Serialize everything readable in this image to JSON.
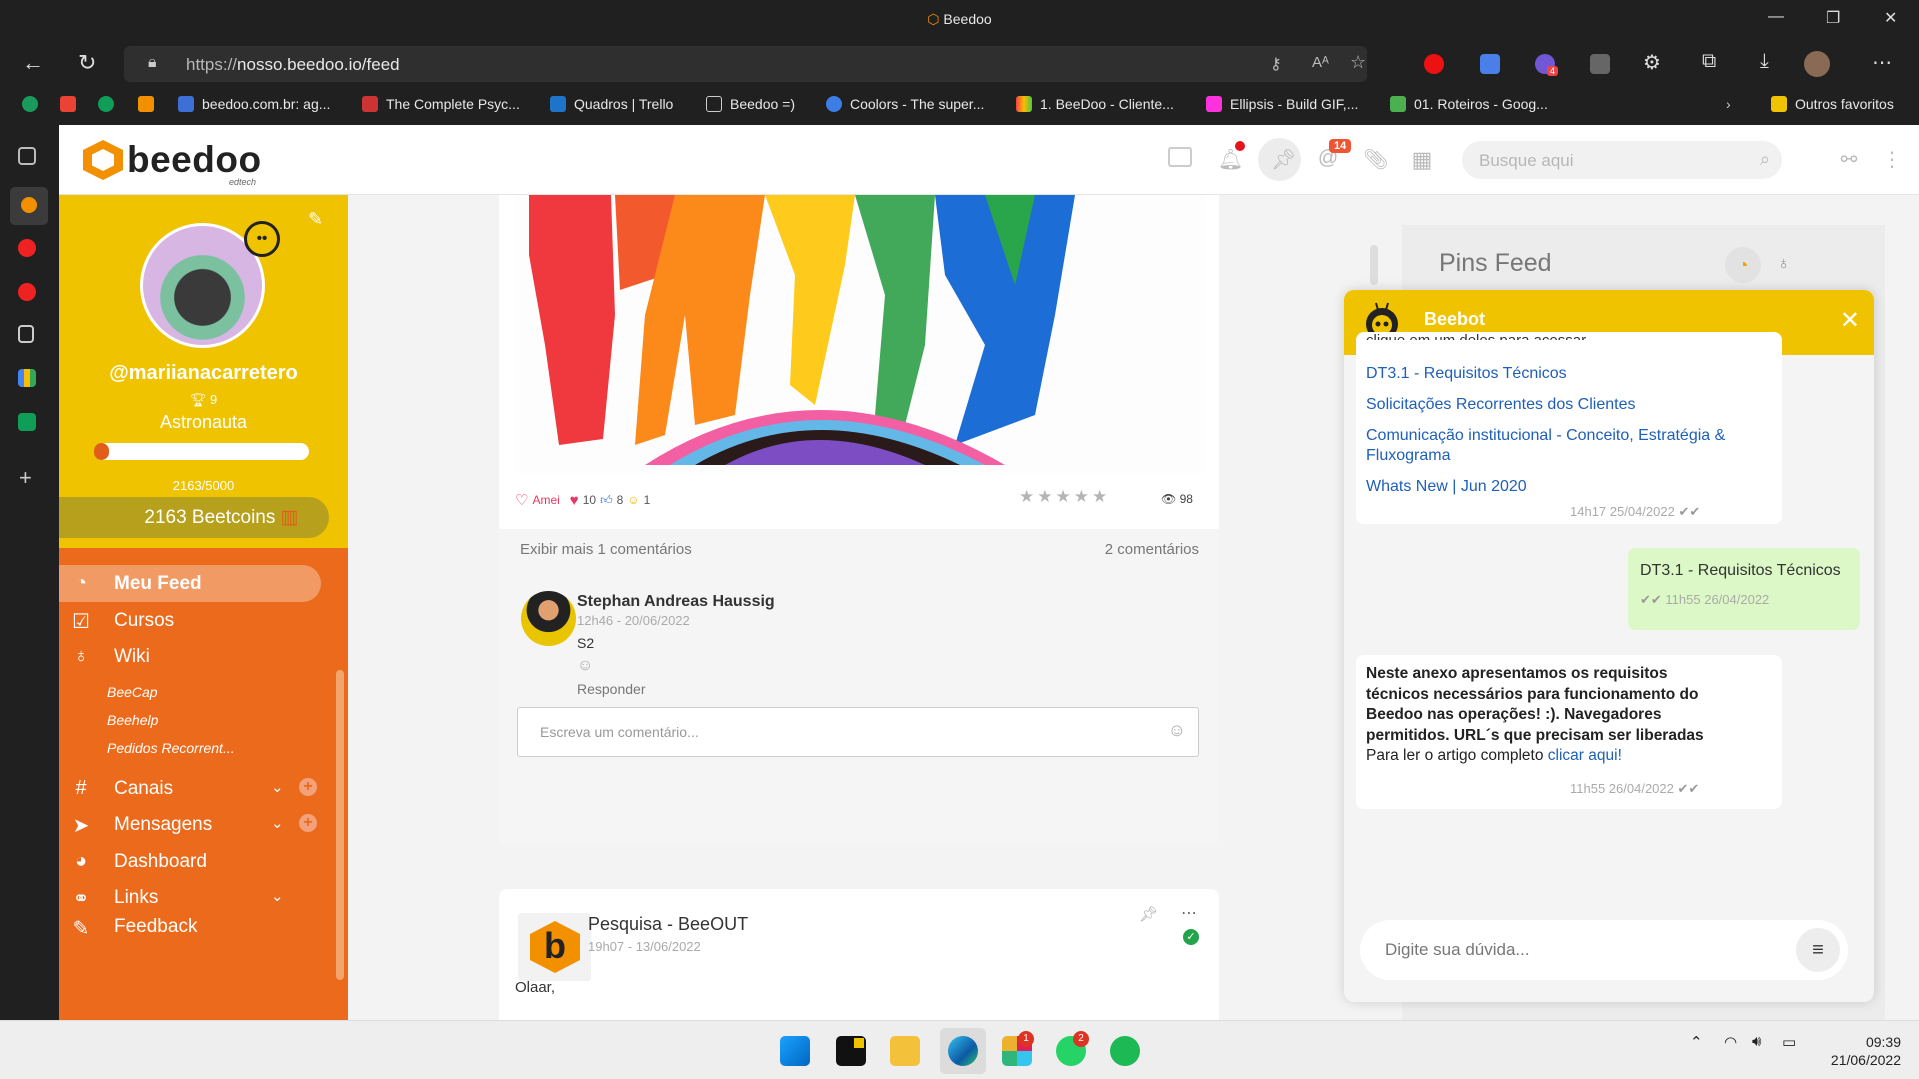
{
  "browser": {
    "window_title": "Beedoo",
    "url_prefix": "https://",
    "url_main": "nosso.beedoo.io/feed",
    "bookmarks": [
      {
        "label": "beedoo.com.br: ag...",
        "color": "#3d6fd6"
      },
      {
        "label": "The Complete Psyc...",
        "color": "#c33"
      },
      {
        "label": "Quadros | Trello",
        "color": "#1e74c8"
      },
      {
        "label": "Beedoo =)",
        "color": "#ddd"
      },
      {
        "label": "Coolors - The super...",
        "color": "#3c7ee6"
      },
      {
        "label": "1. BeeDoo - Cliente...",
        "color": "#e44"
      },
      {
        "label": "Ellipsis - Build GIF,...",
        "color": "#f3d"
      },
      {
        "label": "01. Roteiros - Goog...",
        "color": "#4caf50"
      },
      {
        "label": "Outros favoritos",
        "color": "#f0c300"
      }
    ],
    "extension_badge": "4"
  },
  "app": {
    "brand": "beedoo",
    "brand_sub": "edtech",
    "mentions_badge": "14",
    "search_placeholder": "Busque aqui"
  },
  "profile": {
    "handle": "@mariianacarretero",
    "trophies": "9",
    "rank": "Astronauta",
    "xp_progress": 0.4326,
    "xp_text": "2163/5000",
    "coins": "2163 Beetcoins"
  },
  "menu": {
    "feed": "Meu Feed",
    "courses": "Cursos",
    "wiki": "Wiki",
    "wiki_sub": [
      "BeeCap",
      "Beehelp",
      "Pedidos Recorrent..."
    ],
    "channels": "Canais",
    "messages": "Mensagens",
    "dashboard": "Dashboard",
    "links": "Links",
    "cut": "Feedback"
  },
  "post": {
    "reaction_label": "Amei",
    "love_count": "10",
    "like_count": "8",
    "fun_count": "1",
    "rating_stars": 0,
    "views": "98",
    "show_more": "Exibir mais 1 comentários",
    "comment_count": "2 comentários",
    "comment": {
      "author": "Stephan Andreas Haussig",
      "time": "12h46 - 20/06/2022",
      "text": "S2",
      "reply": "Responder"
    },
    "comment_placeholder": "Escreva um comentário..."
  },
  "post2": {
    "title": "Pesquisa - BeeOUT",
    "time": "19h07 - 13/06/2022",
    "body": "Olaar,"
  },
  "pins": {
    "title": "Pins Feed"
  },
  "chat": {
    "bot_name": "Beebot",
    "msg1_cut": "clique em um deles para acessar.",
    "links": [
      "DT3.1 - Requisitos Técnicos",
      "Solicitações Recorrentes dos Clientes",
      "Comunicação institucional - Conceito, Estratégia &",
      "Fluxograma",
      "Whats New | Jun 2020"
    ],
    "msg1_time": "14h17 25/04/2022",
    "sent_text": "DT3.1 - Requisitos Técnicos",
    "sent_time": "11h55 26/04/2022",
    "reply_bold": [
      "Neste anexo apresentamos os requisitos",
      "técnicos necessários para funcionamento do",
      "Beedoo nas operações! :). Navegadores",
      "permitidos. URL´s que precisam ser liberadas"
    ],
    "reply_text": "Para ler o artigo completo ",
    "reply_link": "clicar aqui!",
    "reply_time": "11h55 26/04/2022",
    "input_placeholder": "Digite sua dúvida..."
  },
  "taskbar": {
    "slack_badge": "1",
    "whatsapp_badge": "2",
    "time": "09:39",
    "date": "21/06/2022"
  }
}
